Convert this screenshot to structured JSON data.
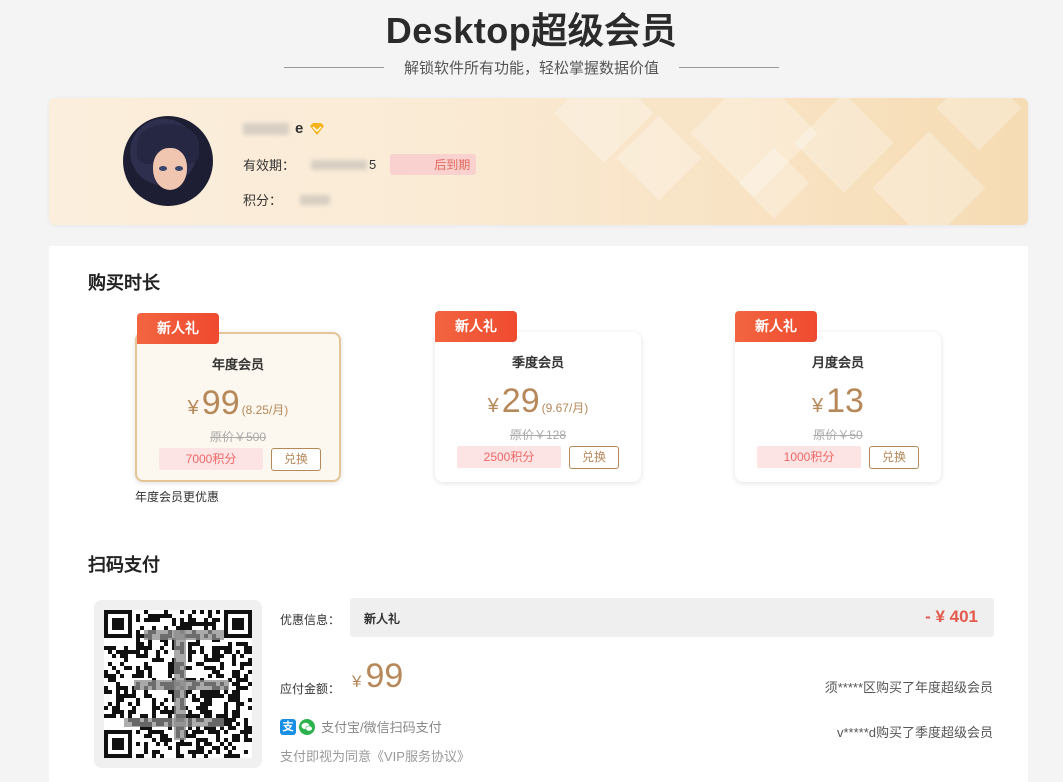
{
  "header": {
    "title": "Desktop超级会员",
    "subtitle": "解锁软件所有功能，轻松掌握数据价值"
  },
  "profile": {
    "username_visible": "e",
    "expiry_label": "有效期：",
    "expiry_visible": "5",
    "expiry_tag": "后到期",
    "points_label": "积分："
  },
  "purchase": {
    "section_title": "购买时长",
    "plans": [
      {
        "badge": "新人礼",
        "name": "年度会员",
        "currency": "¥",
        "price": "99",
        "per_month": "(8.25/月)",
        "original": "原价￥500",
        "points": "7000积分",
        "redeem": "兑换",
        "selected": true
      },
      {
        "badge": "新人礼",
        "name": "季度会员",
        "currency": "¥",
        "price": "29",
        "per_month": "(9.67/月)",
        "original": "原价￥128",
        "points": "2500积分",
        "redeem": "兑换",
        "selected": false
      },
      {
        "badge": "新人礼",
        "name": "月度会员",
        "currency": "¥",
        "price": "13",
        "per_month": "",
        "original": "原价￥50",
        "points": "1000积分",
        "redeem": "兑换",
        "selected": false
      }
    ],
    "note": "年度会员更优惠"
  },
  "payment": {
    "section_title": "扫码支付",
    "discount_label": "优惠信息：",
    "discount_name": "新人礼",
    "discount_amount": "- ¥ 401",
    "amount_label": "应付金额：",
    "amount_currency": "¥",
    "amount": "99",
    "methods_text": "支付宝/微信扫码支付",
    "alipay_glyph": "支",
    "agreement": "支付即视为同意《VIP服务协议》",
    "feed": [
      "须*****区购买了年度超级会员",
      "v*****d购买了季度超级会员"
    ]
  },
  "colors": {
    "accent_gold": "#b6885a",
    "badge_red": "#ef4a2f",
    "discount_red": "#e35b4f",
    "alipay_blue": "#1a8fe3",
    "wechat_green": "#2bb24c"
  },
  "icons": [
    "vip-diamond-icon",
    "alipay-icon",
    "wechat-pay-icon",
    "qr-code"
  ]
}
